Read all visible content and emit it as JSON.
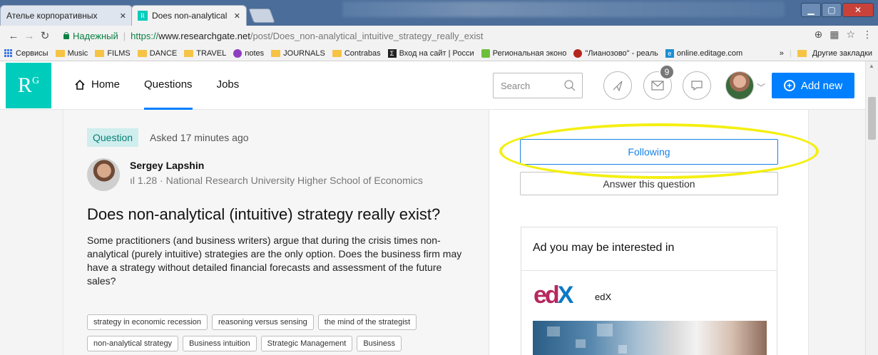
{
  "browser": {
    "tabs": [
      {
        "title": "Ателье корпоративных",
        "active": false
      },
      {
        "title": "Does non-analytical (intu",
        "active": true
      }
    ],
    "address": {
      "secure_label": "Надежный",
      "url_proto": "https://",
      "url_host": "www.researchgate.net",
      "url_path": "/post/Does_non-analytical_intuitive_strategy_really_exist"
    },
    "bookmarks": [
      {
        "label": "Сервисы",
        "icon": "apps-icon"
      },
      {
        "label": "Music",
        "icon": "folder-icon"
      },
      {
        "label": "FILMS",
        "icon": "folder-icon"
      },
      {
        "label": "DANCE",
        "icon": "folder-icon"
      },
      {
        "label": "TRAVEL",
        "icon": "folder-icon"
      },
      {
        "label": "notes",
        "icon": "notes-icon"
      },
      {
        "label": "JOURNALS",
        "icon": "folder-icon"
      },
      {
        "label": "Contrabas",
        "icon": "folder-icon"
      },
      {
        "label": "Вход на сайт | Росси",
        "icon": "sigma-icon"
      },
      {
        "label": "Региональная эконо",
        "icon": "leaf-icon"
      },
      {
        "label": "\"Лианозово\" - реаль",
        "icon": "brand-icon"
      },
      {
        "label": "online.editage.com",
        "icon": "editage-icon"
      }
    ],
    "bookmarks_more": "»",
    "bookmarks_other": "Другие закладки"
  },
  "site": {
    "logo": "R",
    "logo_sup": "G",
    "nav": [
      {
        "label": "Home",
        "active": false
      },
      {
        "label": "Questions",
        "active": true
      },
      {
        "label": "Jobs",
        "active": false
      }
    ],
    "search_placeholder": "Search",
    "messages_badge": "9",
    "add_new_label": "Add new"
  },
  "question": {
    "tag": "Question",
    "asked": "Asked 17 minutes ago",
    "author_name": "Sergey Lapshin",
    "author_meta": "ıl 1.28 · National Research University Higher School of Economics",
    "title": "Does non-analytical (intuitive) strategy really exist?",
    "body": "Some practitioners (and business writers) argue that during the crisis times non-analytical (purely intuitive) strategies are the only option. Does the business firm may have a strategy without detailed financial forecasts and assessment of the future sales?",
    "topics": [
      "strategy in economic recession",
      "reasoning versus sensing",
      "the mind of the strategist",
      "non-analytical strategy",
      "Business intuition",
      "Strategic Management",
      "Business"
    ]
  },
  "sidebar": {
    "following_label": "Following",
    "answer_label": "Answer this question",
    "ad_title": "Ad you may be interested in",
    "ad_brand": "edX"
  },
  "colors": {
    "brand": "#00ccbb",
    "primary": "#0080ff",
    "highlight": "#f4ef11"
  }
}
